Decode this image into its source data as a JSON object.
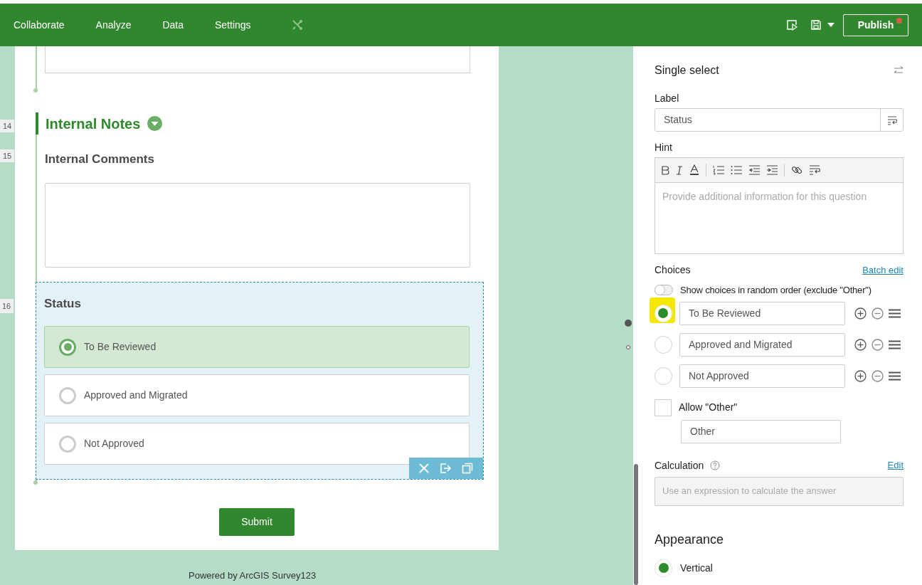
{
  "toolbar": {
    "tabs": [
      {
        "label": "Collaborate"
      },
      {
        "label": "Analyze"
      },
      {
        "label": "Data"
      },
      {
        "label": "Settings"
      }
    ],
    "publish": {
      "label": "Publish",
      "unsaved": true
    }
  },
  "form": {
    "section": {
      "number": "14",
      "title": "Internal Notes",
      "expanded": true
    },
    "comments": {
      "number": "15",
      "label": "Internal Comments"
    },
    "status": {
      "number": "16",
      "label": "Status",
      "selected": true,
      "choices": [
        {
          "label": "To Be Reviewed",
          "selected": true
        },
        {
          "label": "Approved and Migrated",
          "selected": false
        },
        {
          "label": "Not Approved",
          "selected": false
        }
      ]
    },
    "submit": "Submit",
    "footer": "Powered by ArcGIS Survey123"
  },
  "panel": {
    "title": "Single select",
    "label": {
      "caption": "Label",
      "value": "Status"
    },
    "hint": {
      "caption": "Hint",
      "placeholder": "Provide additional information for this question"
    },
    "choices": {
      "caption": "Choices",
      "batch_edit": "Batch edit",
      "random_order": {
        "label": "Show choices in random order (exclude \"Other\")",
        "on": false
      },
      "items": [
        {
          "label": "To Be Reviewed",
          "selected": true
        },
        {
          "label": "Approved and Migrated",
          "selected": false
        },
        {
          "label": "Not Approved",
          "selected": false
        }
      ],
      "allow_other": {
        "label": "Allow \"Other\"",
        "checked": false,
        "value": "Other"
      }
    },
    "calculation": {
      "caption": "Calculation",
      "edit": "Edit",
      "placeholder": "Use an expression to calculate the answer"
    },
    "appearance": {
      "title": "Appearance",
      "options": [
        {
          "label": "Vertical",
          "selected": true
        }
      ]
    }
  }
}
